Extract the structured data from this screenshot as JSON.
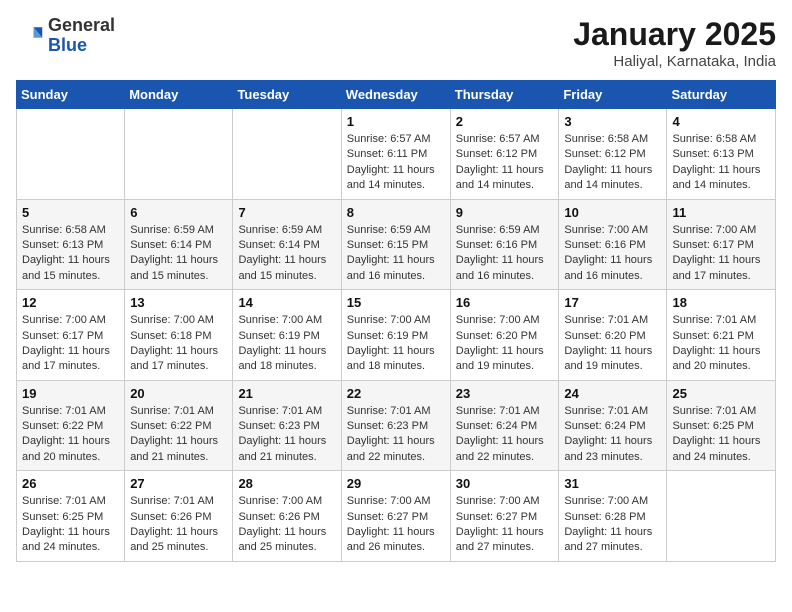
{
  "header": {
    "logo": {
      "general": "General",
      "blue": "Blue"
    },
    "title": "January 2025",
    "location": "Haliyal, Karnataka, India"
  },
  "weekdays": [
    "Sunday",
    "Monday",
    "Tuesday",
    "Wednesday",
    "Thursday",
    "Friday",
    "Saturday"
  ],
  "weeks": [
    [
      null,
      null,
      null,
      {
        "day": 1,
        "sunrise": "6:57 AM",
        "sunset": "6:11 PM",
        "daylight": "11 hours and 14 minutes."
      },
      {
        "day": 2,
        "sunrise": "6:57 AM",
        "sunset": "6:12 PM",
        "daylight": "11 hours and 14 minutes."
      },
      {
        "day": 3,
        "sunrise": "6:58 AM",
        "sunset": "6:12 PM",
        "daylight": "11 hours and 14 minutes."
      },
      {
        "day": 4,
        "sunrise": "6:58 AM",
        "sunset": "6:13 PM",
        "daylight": "11 hours and 14 minutes."
      }
    ],
    [
      {
        "day": 5,
        "sunrise": "6:58 AM",
        "sunset": "6:13 PM",
        "daylight": "11 hours and 15 minutes."
      },
      {
        "day": 6,
        "sunrise": "6:59 AM",
        "sunset": "6:14 PM",
        "daylight": "11 hours and 15 minutes."
      },
      {
        "day": 7,
        "sunrise": "6:59 AM",
        "sunset": "6:14 PM",
        "daylight": "11 hours and 15 minutes."
      },
      {
        "day": 8,
        "sunrise": "6:59 AM",
        "sunset": "6:15 PM",
        "daylight": "11 hours and 16 minutes."
      },
      {
        "day": 9,
        "sunrise": "6:59 AM",
        "sunset": "6:16 PM",
        "daylight": "11 hours and 16 minutes."
      },
      {
        "day": 10,
        "sunrise": "7:00 AM",
        "sunset": "6:16 PM",
        "daylight": "11 hours and 16 minutes."
      },
      {
        "day": 11,
        "sunrise": "7:00 AM",
        "sunset": "6:17 PM",
        "daylight": "11 hours and 17 minutes."
      }
    ],
    [
      {
        "day": 12,
        "sunrise": "7:00 AM",
        "sunset": "6:17 PM",
        "daylight": "11 hours and 17 minutes."
      },
      {
        "day": 13,
        "sunrise": "7:00 AM",
        "sunset": "6:18 PM",
        "daylight": "11 hours and 17 minutes."
      },
      {
        "day": 14,
        "sunrise": "7:00 AM",
        "sunset": "6:19 PM",
        "daylight": "11 hours and 18 minutes."
      },
      {
        "day": 15,
        "sunrise": "7:00 AM",
        "sunset": "6:19 PM",
        "daylight": "11 hours and 18 minutes."
      },
      {
        "day": 16,
        "sunrise": "7:00 AM",
        "sunset": "6:20 PM",
        "daylight": "11 hours and 19 minutes."
      },
      {
        "day": 17,
        "sunrise": "7:01 AM",
        "sunset": "6:20 PM",
        "daylight": "11 hours and 19 minutes."
      },
      {
        "day": 18,
        "sunrise": "7:01 AM",
        "sunset": "6:21 PM",
        "daylight": "11 hours and 20 minutes."
      }
    ],
    [
      {
        "day": 19,
        "sunrise": "7:01 AM",
        "sunset": "6:22 PM",
        "daylight": "11 hours and 20 minutes."
      },
      {
        "day": 20,
        "sunrise": "7:01 AM",
        "sunset": "6:22 PM",
        "daylight": "11 hours and 21 minutes."
      },
      {
        "day": 21,
        "sunrise": "7:01 AM",
        "sunset": "6:23 PM",
        "daylight": "11 hours and 21 minutes."
      },
      {
        "day": 22,
        "sunrise": "7:01 AM",
        "sunset": "6:23 PM",
        "daylight": "11 hours and 22 minutes."
      },
      {
        "day": 23,
        "sunrise": "7:01 AM",
        "sunset": "6:24 PM",
        "daylight": "11 hours and 22 minutes."
      },
      {
        "day": 24,
        "sunrise": "7:01 AM",
        "sunset": "6:24 PM",
        "daylight": "11 hours and 23 minutes."
      },
      {
        "day": 25,
        "sunrise": "7:01 AM",
        "sunset": "6:25 PM",
        "daylight": "11 hours and 24 minutes."
      }
    ],
    [
      {
        "day": 26,
        "sunrise": "7:01 AM",
        "sunset": "6:25 PM",
        "daylight": "11 hours and 24 minutes."
      },
      {
        "day": 27,
        "sunrise": "7:01 AM",
        "sunset": "6:26 PM",
        "daylight": "11 hours and 25 minutes."
      },
      {
        "day": 28,
        "sunrise": "7:00 AM",
        "sunset": "6:26 PM",
        "daylight": "11 hours and 25 minutes."
      },
      {
        "day": 29,
        "sunrise": "7:00 AM",
        "sunset": "6:27 PM",
        "daylight": "11 hours and 26 minutes."
      },
      {
        "day": 30,
        "sunrise": "7:00 AM",
        "sunset": "6:27 PM",
        "daylight": "11 hours and 27 minutes."
      },
      {
        "day": 31,
        "sunrise": "7:00 AM",
        "sunset": "6:28 PM",
        "daylight": "11 hours and 27 minutes."
      },
      null
    ]
  ]
}
